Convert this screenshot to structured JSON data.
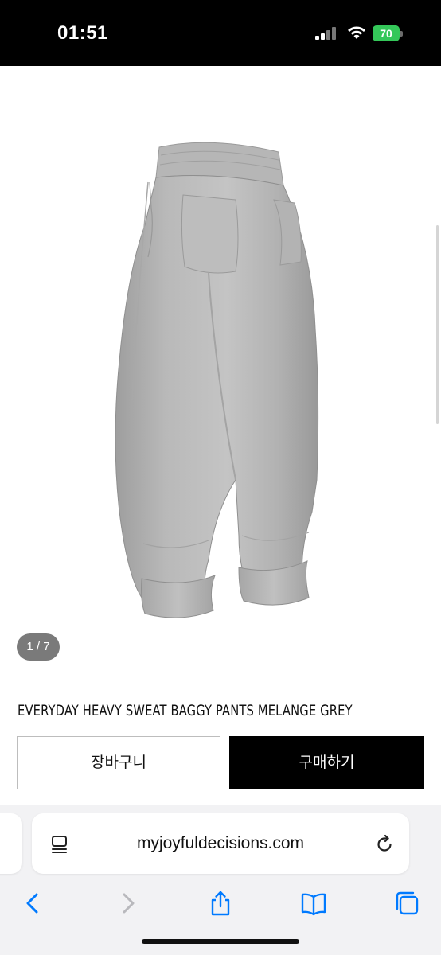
{
  "status_bar": {
    "time": "01:51",
    "battery_level": "70",
    "battery_color": "#34c759"
  },
  "product": {
    "image_alt": "grey baggy sweat pants",
    "image_counter": "1 / 7",
    "title": "EVERYDAY HEAVY SWEAT BAGGY PANTS MELANGE GREY"
  },
  "actions": {
    "cart_label": "장바구니",
    "buy_label": "구매하기"
  },
  "browser": {
    "url": "myjoyfuldecisions.com",
    "icons": {
      "page_menu": "page-menu-icon",
      "reload": "reload-icon",
      "back": "chevron-left-icon",
      "forward": "chevron-right-icon",
      "share": "share-icon",
      "bookmarks": "book-icon",
      "tabs": "tabs-icon"
    },
    "accent_color": "#007aff"
  }
}
